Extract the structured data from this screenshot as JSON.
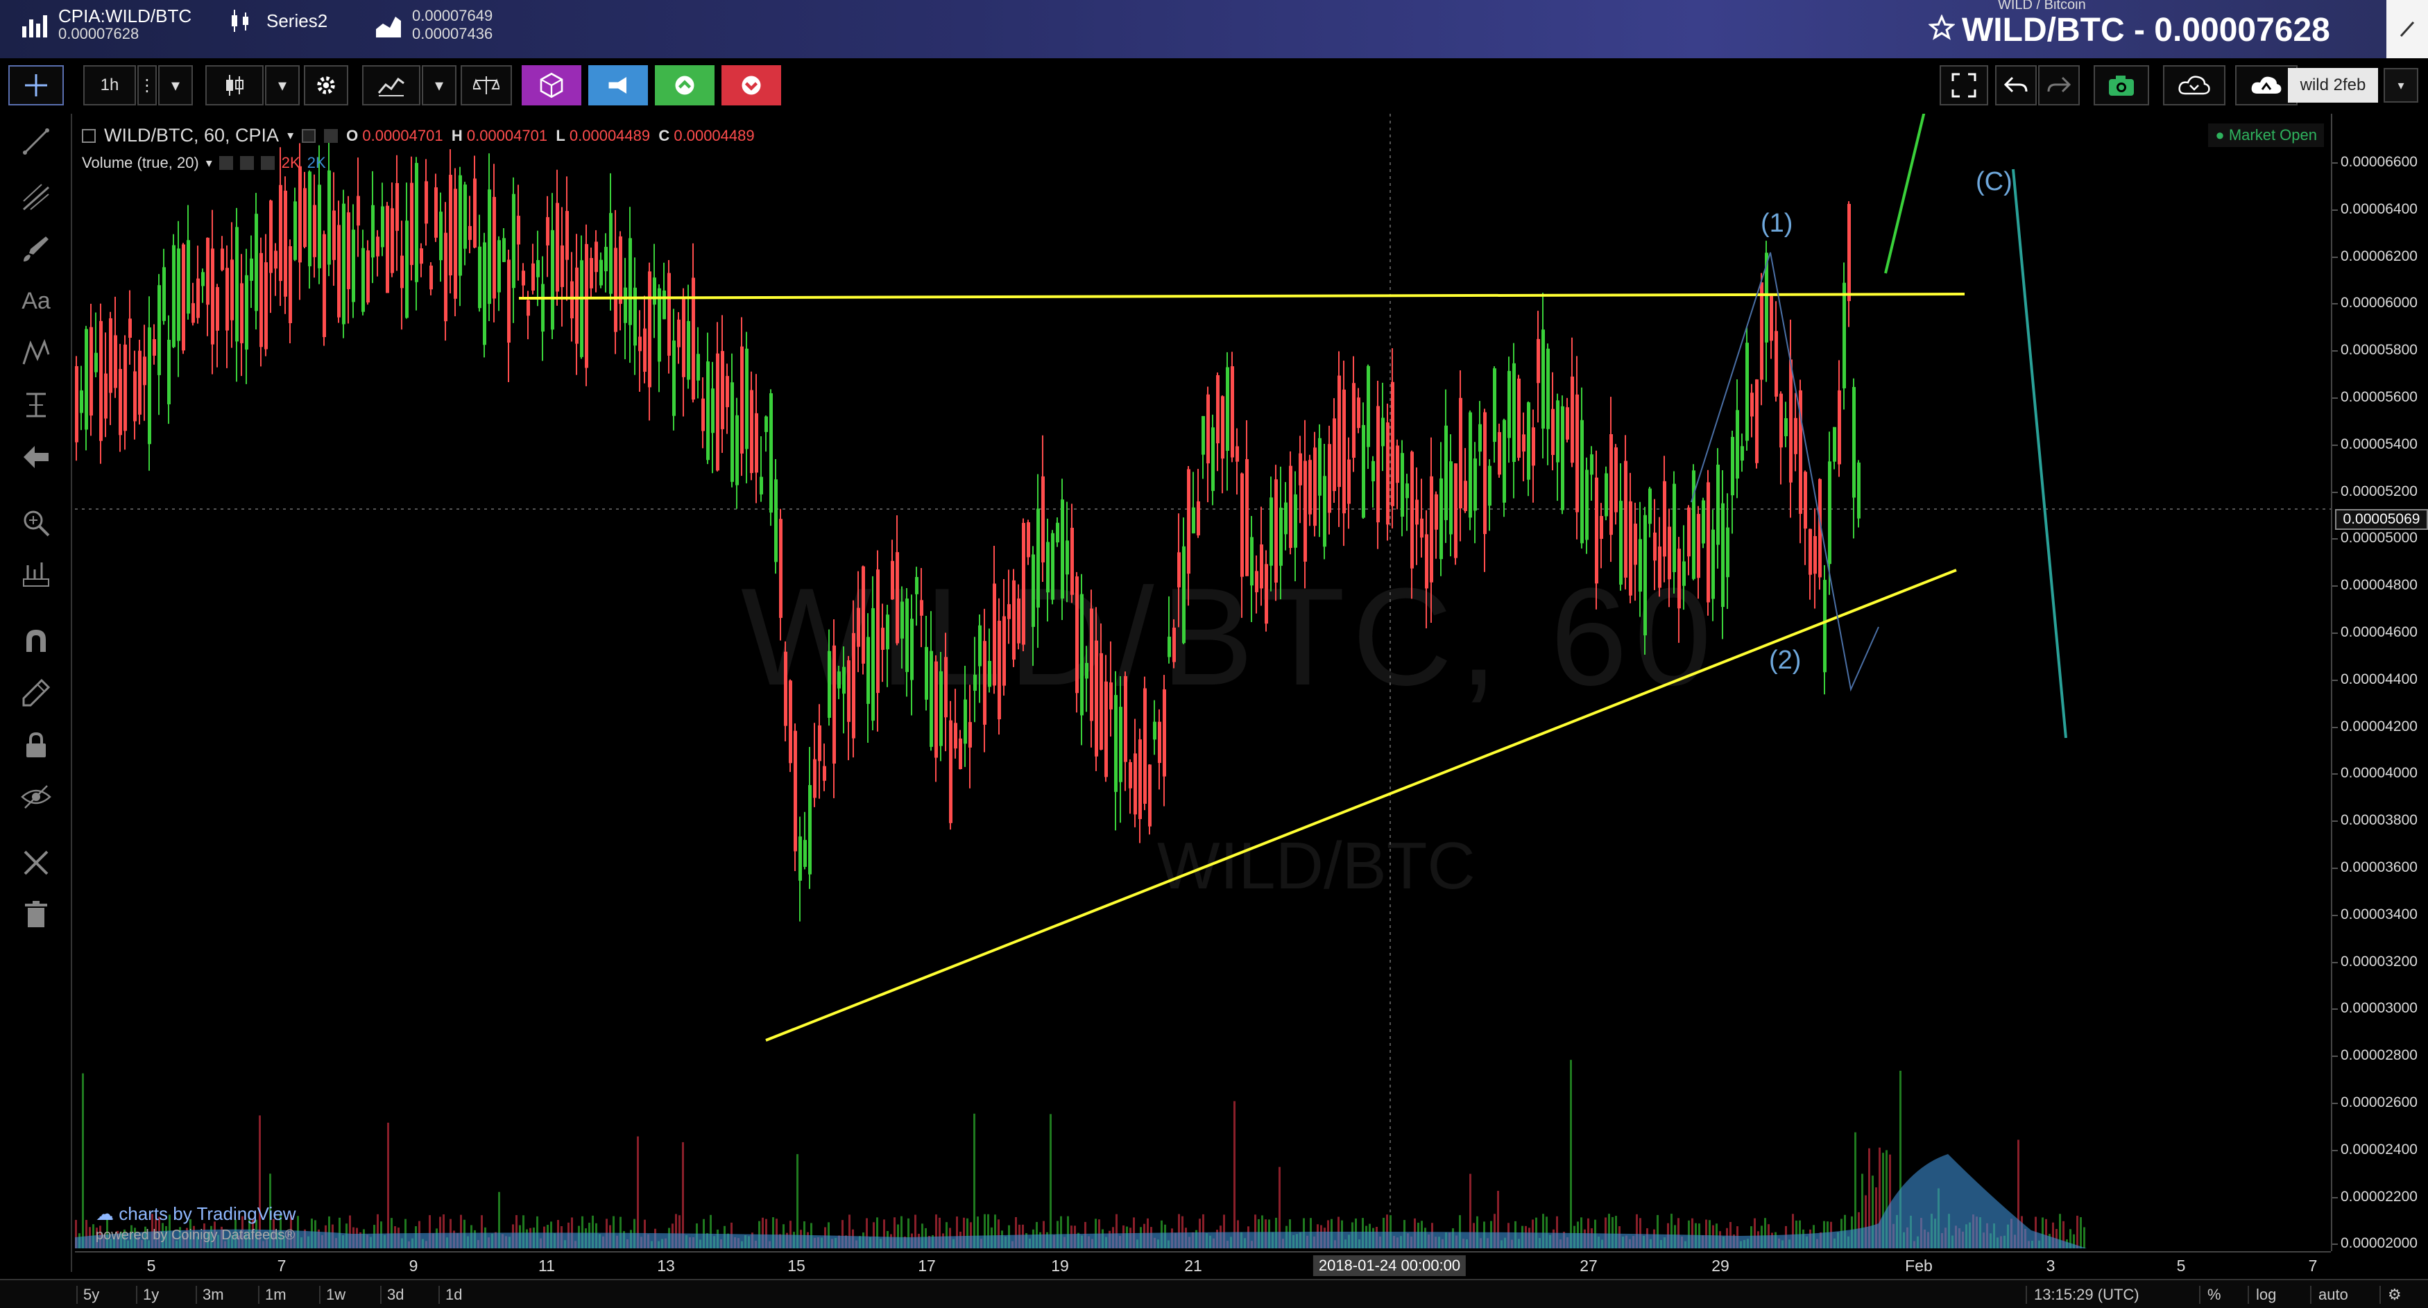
{
  "header": {
    "symbol": "CPIA:WILD/BTC",
    "symbol_price": "0.00007628",
    "series_label": "Series2",
    "series_hi": "0.00007649",
    "series_lo": "0.00007436",
    "pair_small": "WILD / Bitcoin",
    "pair_big": "WILD/BTC - 0.00007628",
    "star_icon": "star-icon"
  },
  "toolbar": {
    "interval": "1h",
    "chart_name": "wild 2feb"
  },
  "legend": {
    "title": "WILD/BTC, 60, CPIA",
    "o_label": "O",
    "o_val": "0.00004701",
    "h_label": "H",
    "h_val": "0.00004701",
    "l_label": "L",
    "l_val": "0.00004489",
    "c_label": "C",
    "c_val": "0.00004489",
    "volume": "Volume (true, 20)",
    "vol_a": "2K",
    "vol_b": "2K",
    "market_status": "Market Open"
  },
  "watermark": {
    "main": "WILD/BTC, 60",
    "sub": "WILD/BTC"
  },
  "annotations": {
    "wave1": "(1)",
    "wave2": "(2)",
    "waveC": "(C)"
  },
  "branding": {
    "line1": "charts by TradingView",
    "line2": "powered by Coinigy Datafeeds®"
  },
  "price_axis": {
    "ticks": [
      "0.00006600",
      "0.00006400",
      "0.00006200",
      "0.00006000",
      "0.00005800",
      "0.00005600",
      "0.00005400",
      "0.00005200",
      "0.00005000",
      "0.00004800",
      "0.00004600",
      "0.00004400",
      "0.00004200",
      "0.00004000",
      "0.00003800",
      "0.00003600",
      "0.00003400",
      "0.00003200",
      "0.00003000",
      "0.00002800",
      "0.00002600",
      "0.00002400",
      "0.00002200",
      "0.00002000"
    ],
    "last_price": "0.00005069"
  },
  "time_axis": {
    "ticks": [
      "5",
      "7",
      "9",
      "11",
      "13",
      "15",
      "17",
      "19",
      "21",
      "27",
      "29",
      "Feb",
      "3",
      "5",
      "7"
    ],
    "crosshair_label": "2018-01-24 00:00:00"
  },
  "bottom_bar": {
    "ranges": [
      "5y",
      "1y",
      "3m",
      "1m",
      "1w",
      "3d",
      "1d"
    ],
    "clock": "13:15:29 (UTC)",
    "percent": "%",
    "log": "log",
    "auto": "auto"
  },
  "colors": {
    "up": "#3ad13a",
    "down": "#ff4d4d",
    "trendline": "#ffff33",
    "accent_purple": "#9a2bb5",
    "accent_blue": "#3d8fd6",
    "accent_green": "#3fb64a",
    "accent_red": "#d9333f"
  }
}
